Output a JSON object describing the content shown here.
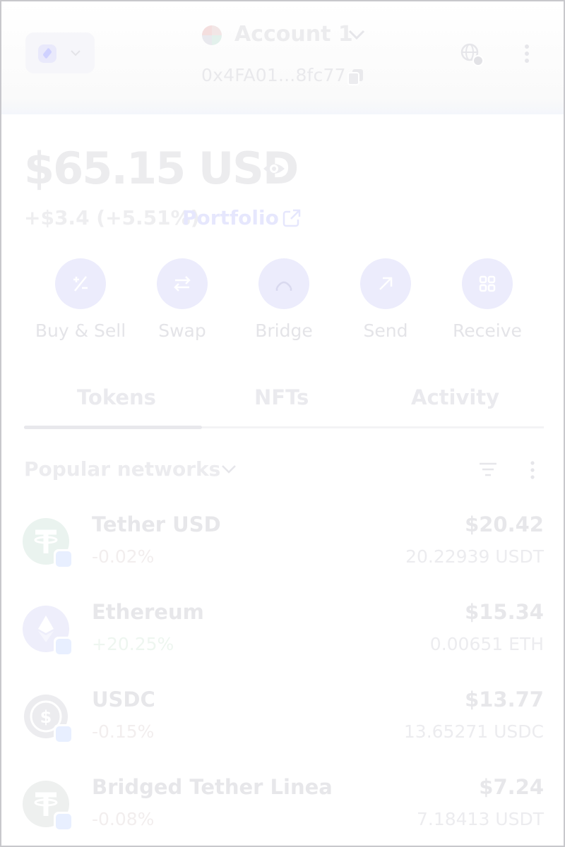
{
  "header": {
    "account_name": "Account 1",
    "address": "0x4FA01...8fc77"
  },
  "balance": {
    "amount": "$65.15 USD",
    "change": "+$3.4 (+5.51%)",
    "portfolio_label": "Portfolio"
  },
  "actions": [
    {
      "label": "Buy & Sell",
      "icon": "buy-sell-icon"
    },
    {
      "label": "Swap",
      "icon": "swap-icon"
    },
    {
      "label": "Bridge",
      "icon": "bridge-icon"
    },
    {
      "label": "Send",
      "icon": "send-arrow-icon"
    },
    {
      "label": "Receive",
      "icon": "qr-scan-icon"
    }
  ],
  "tabs": [
    {
      "label": "Tokens",
      "active": true
    },
    {
      "label": "NFTs",
      "active": false
    },
    {
      "label": "Activity",
      "active": false
    }
  ],
  "filter": {
    "network_label": "Popular networks"
  },
  "tokens": [
    {
      "name": "Tether USD",
      "change": "-0.02%",
      "fiat": "$20.42",
      "amount": "20.22939 USDT",
      "icon": "tether-logo"
    },
    {
      "name": "Ethereum",
      "change": "+20.25%",
      "fiat": "$15.34",
      "amount": "0.00651 ETH",
      "icon": "ethereum-logo"
    },
    {
      "name": "USDC",
      "change": "-0.15%",
      "fiat": "$13.77",
      "amount": "13.65271 USDC",
      "icon": "usdc-logo"
    },
    {
      "name": "Bridged Tether Linea",
      "change": "-0.08%",
      "fiat": "$7.24",
      "amount": "7.18413 USDT",
      "icon": "tether-logo"
    }
  ],
  "colors": {
    "accent": "#e6e7fd",
    "text_faded": "#e7e7ea",
    "negative": "#f2eeee",
    "positive": "#eef6f0"
  }
}
